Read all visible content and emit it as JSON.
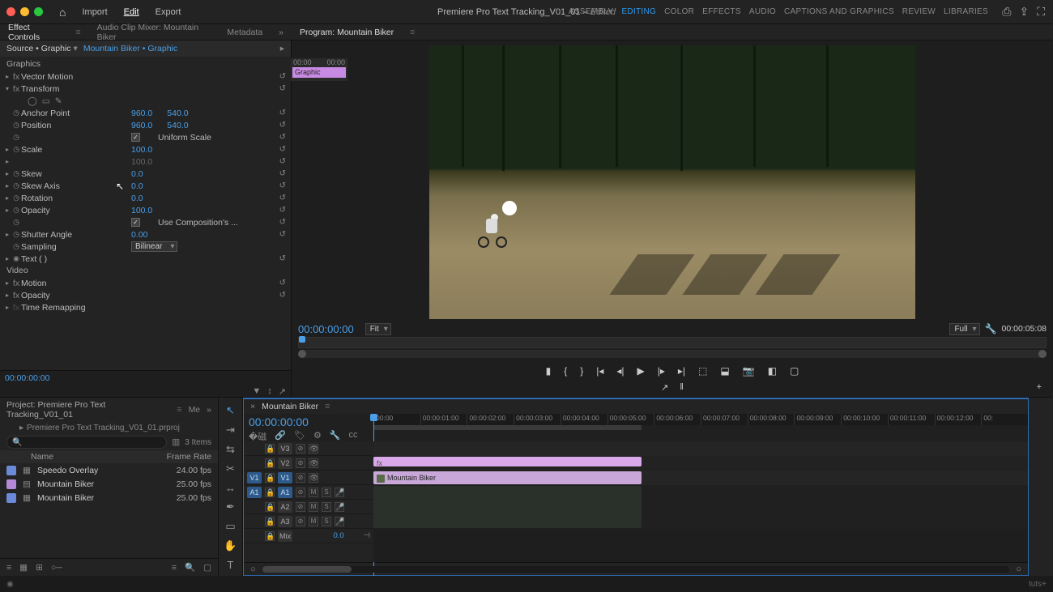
{
  "title": {
    "doc": "Premiere Pro Text Tracking_V01_01",
    "suffix": "Edited"
  },
  "topmenu": {
    "import": "Import",
    "edit": "Edit",
    "export": "Export"
  },
  "workspaces": {
    "assembly": "ASSEMBLY",
    "editing": "EDITING",
    "color": "COLOR",
    "effects": "EFFECTS",
    "audio": "AUDIO",
    "cg": "CAPTIONS AND GRAPHICS",
    "review": "REVIEW",
    "libraries": "LIBRARIES"
  },
  "panelTabs": {
    "effectControls": "Effect Controls",
    "audioMixer": "Audio Clip Mixer: Mountain Biker",
    "metadata": "Metadata"
  },
  "source": {
    "left": "Source • Graphic",
    "right": "Mountain Biker • Graphic",
    "miniStart": "00:00",
    "miniEnd": "00:00",
    "miniLabel": "Graphic"
  },
  "fx": {
    "graphics": "Graphics",
    "vectorMotion": "Vector Motion",
    "transform": "Transform",
    "anchor": {
      "label": "Anchor Point",
      "x": "960.0",
      "y": "540.0"
    },
    "position": {
      "label": "Position",
      "x": "960.0",
      "y": "540.0"
    },
    "uniform": {
      "label": "Uniform Scale"
    },
    "scale": {
      "label": "Scale",
      "v": "100.0"
    },
    "scale2": {
      "v": "100.0"
    },
    "skew": {
      "label": "Skew",
      "v": "0.0"
    },
    "skewAxis": {
      "label": "Skew Axis",
      "v": "0.0"
    },
    "rotation": {
      "label": "Rotation",
      "v": "0.0"
    },
    "opacity": {
      "label": "Opacity",
      "v": "100.0"
    },
    "useComp": {
      "label": "Use Composition's ..."
    },
    "shutter": {
      "label": "Shutter Angle",
      "v": "0.00"
    },
    "sampling": {
      "label": "Sampling",
      "v": "Bilinear"
    },
    "text": {
      "label": "Text ( )"
    },
    "video": "Video",
    "motion": "Motion",
    "opacity2": "Opacity",
    "timeRemap": "Time Remapping"
  },
  "tcBottom": "00:00:00:00",
  "program": {
    "tab": "Program: Mountain Biker",
    "tc": "00:00:00:00",
    "fit": "Fit",
    "full": "Full",
    "dur": "00:00:05:08"
  },
  "project": {
    "tab": "Project: Premiere Pro Text Tracking_V01_01",
    "me": "Me",
    "path": "Premiere Pro Text Tracking_V01_01.prproj",
    "count": "3 Items",
    "colName": "Name",
    "colRate": "Frame Rate",
    "items": [
      {
        "name": "Speedo Overlay",
        "rate": "24.00 fps",
        "color": "#6a8ad8"
      },
      {
        "name": "Mountain Biker",
        "rate": "25.00 fps",
        "color": "#b48ad8"
      },
      {
        "name": "Mountain Biker",
        "rate": "25.00 fps",
        "color": "#6a8ad8"
      }
    ]
  },
  "timeline": {
    "tab": "Mountain Biker",
    "tc": "00:00:00:00",
    "ticks": [
      "00:00",
      "00:00:01:00",
      "00:00:02:00",
      "00:00:03:00",
      "00:00:04:00",
      "00:00:05:00",
      "00:00:06:00",
      "00:00:07:00",
      "00:00:08:00",
      "00:00:09:00",
      "00:00:10:00",
      "00:00:11:00",
      "00:00:12:00",
      "00:"
    ],
    "tracks": {
      "v3": "V3",
      "v2": "V2",
      "v1": "V1",
      "a1": "A1",
      "a2": "A2",
      "a3": "A3",
      "mix": "Mix",
      "mixv": "0.0"
    },
    "clips": {
      "gfx": "fx",
      "vid": "Mountain Biker"
    }
  },
  "footer": {
    "brand": "tuts+"
  }
}
